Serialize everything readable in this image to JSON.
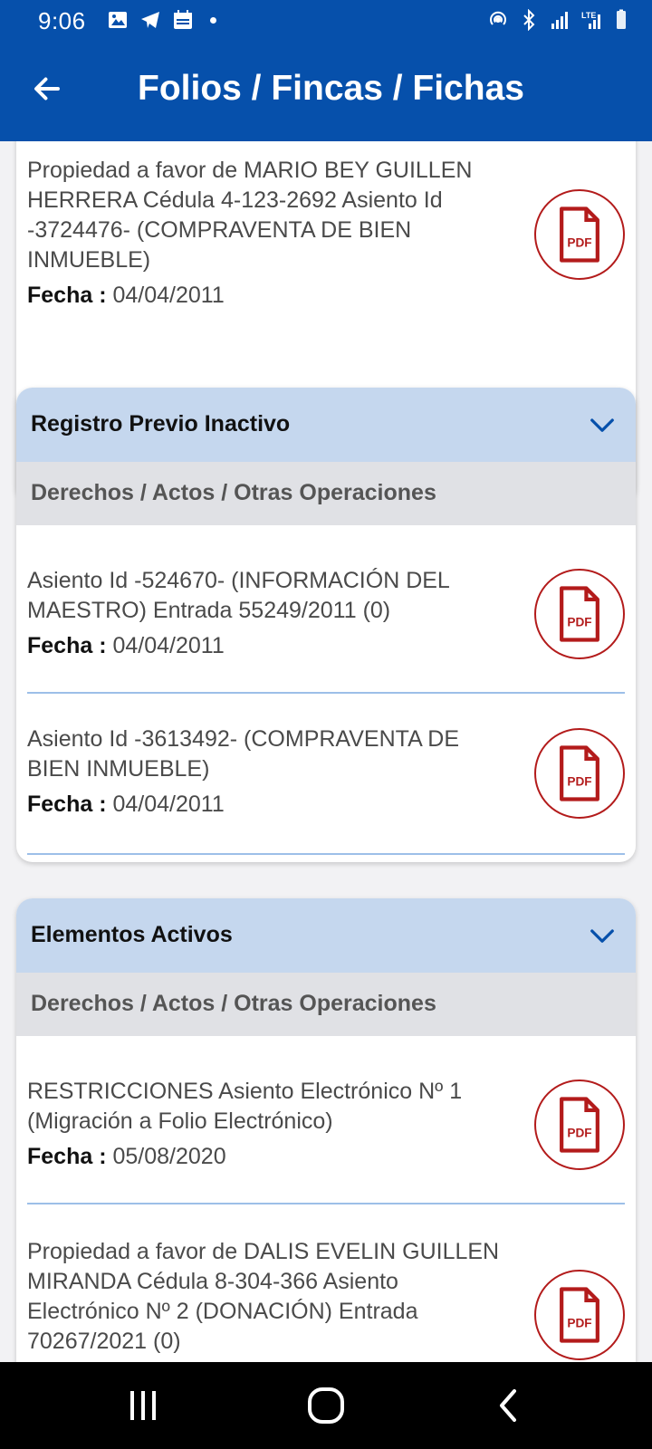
{
  "status_bar": {
    "time": "9:06",
    "left_icons": [
      "image-icon",
      "telegram-icon",
      "calendar-icon"
    ],
    "right_icons": [
      "hotspot-icon",
      "bluetooth-icon",
      "signal-icon",
      "lte-signal-icon",
      "battery-icon"
    ],
    "network_label": "LTE"
  },
  "app_bar": {
    "title": "Folios / Fincas / Fichas"
  },
  "pdf_label": "PDF",
  "top_card": {
    "entries": [
      {
        "text": "Propiedad a favor de MARIO BEY GUILLEN HERRERA Cédula 4-123-2692 Asiento Id -3724476- (COMPRAVENTA DE BIEN INMUEBLE)",
        "fecha_label": "Fecha :",
        "fecha": "04/04/2011"
      }
    ]
  },
  "section_inactive": {
    "title": "Registro Previo Inactivo",
    "subheader": "Derechos / Actos / Otras Operaciones",
    "entries": [
      {
        "text": "Asiento Id -524670- (INFORMACIÓN DEL MAESTRO) Entrada 55249/2011 (0)",
        "fecha_label": "Fecha :",
        "fecha": "04/04/2011"
      },
      {
        "text": "Asiento Id -3613492- (COMPRAVENTA DE BIEN INMUEBLE)",
        "fecha_label": "Fecha :",
        "fecha": "04/04/2011"
      }
    ]
  },
  "section_active": {
    "title": "Elementos Activos",
    "subheader": "Derechos / Actos / Otras Operaciones",
    "entries": [
      {
        "text": "RESTRICCIONES Asiento Electrónico Nº 1 (Migración a Folio Electrónico)",
        "fecha_label": "Fecha :",
        "fecha": "05/08/2020"
      },
      {
        "text": "Propiedad a favor de DALIS EVELIN GUILLEN MIRANDA Cédula 8-304-366 Asiento Electrónico Nº 2 (DONACIÓN) Entrada 70267/2021 (0)",
        "fecha_label": "",
        "fecha": ""
      }
    ]
  },
  "colors": {
    "brand_blue": "#0650ab",
    "section_header_bg": "#c5d7ee",
    "subheader_bg": "#e0e1e5",
    "pdf_red": "#b31b1b",
    "divider_blue": "#9dbfe8"
  }
}
